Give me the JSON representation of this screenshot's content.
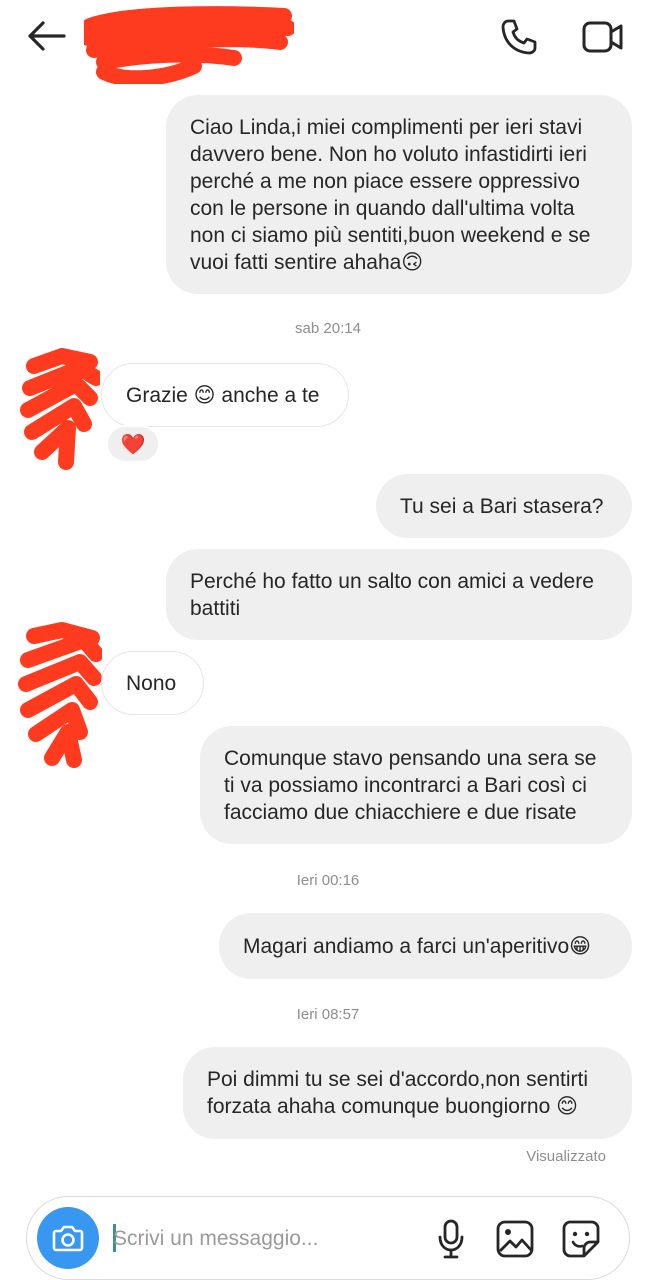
{
  "header": {
    "back_icon": "arrow-left-icon",
    "call_icon": "phone-icon",
    "video_icon": "video-camera-icon",
    "redaction_color": "#ff3b1f"
  },
  "messages": [
    {
      "side": "out",
      "text": "Ciao Linda,i miei complimenti per ieri stavi\ndavvero bene. Non ho voluto infastidirti ieri\nperché a me non piace essere oppressivo\ncon le persone in quando dall'ultima volta\nnon ci siamo più sentiti,buon weekend e se\nvuoi fatti sentire ahaha🙃"
    },
    {
      "type": "timestamp",
      "text": "sab 20:14"
    },
    {
      "side": "in",
      "text": "Grazie 😊 anche a te",
      "reaction": "❤️"
    },
    {
      "side": "out",
      "text": "Tu sei a Bari stasera?"
    },
    {
      "side": "out",
      "text": "Perché ho fatto un salto con amici a vedere\nbattiti"
    },
    {
      "side": "in",
      "text": "Nono"
    },
    {
      "side": "out",
      "text": "Comunque stavo pensando una sera se\nti va possiamo incontrarci a Bari così ci\nfacciamo due chiacchiere e due risate"
    },
    {
      "type": "timestamp",
      "text": "Ieri 00:16"
    },
    {
      "side": "out",
      "text": "Magari andiamo a farci un'aperitivo😁"
    },
    {
      "type": "timestamp",
      "text": "Ieri 08:57"
    },
    {
      "side": "out",
      "text": "Poi dimmi tu se sei d'accordo,non sentirti\nforzata ahaha comunque buongiorno 😊"
    }
  ],
  "seen_label": "Visualizzato",
  "composer": {
    "placeholder": "Scrivi un messaggio...",
    "camera_icon": "camera-icon",
    "mic_icon": "microphone-icon",
    "gallery_icon": "image-icon",
    "sticker_icon": "sticker-icon",
    "camera_color": "#3897f0"
  }
}
